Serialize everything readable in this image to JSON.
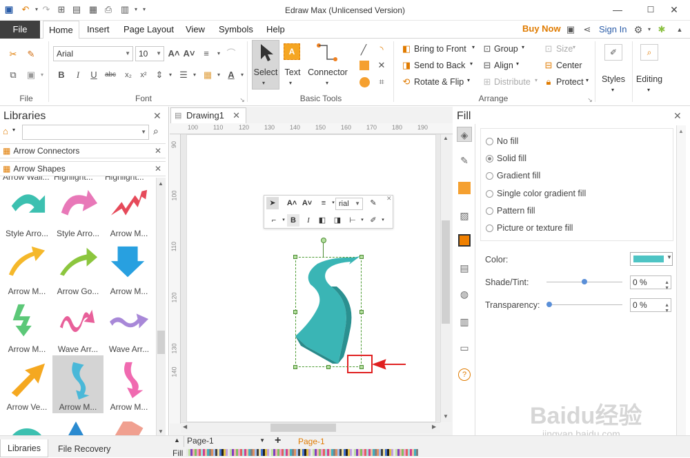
{
  "window": {
    "title": "Edraw Max (Unlicensed Version)"
  },
  "menu": {
    "file": "File",
    "tabs": [
      "Home",
      "Insert",
      "Page Layout",
      "View",
      "Symbols",
      "Help"
    ],
    "buy_now": "Buy Now",
    "sign_in": "Sign In"
  },
  "ribbon": {
    "groups": {
      "file": "File",
      "font": "Font",
      "basic_tools": "Basic Tools",
      "arrange": "Arrange"
    },
    "font_name": "Arial",
    "font_size": "10",
    "tools": {
      "select": "Select",
      "text": "Text",
      "connector": "Connector"
    },
    "arrange": {
      "bring_to_front": "Bring to Front",
      "send_to_back": "Send to Back",
      "rotate_flip": "Rotate & Flip",
      "group": "Group",
      "align": "Align",
      "distribute": "Distribute",
      "size": "Size",
      "center": "Center",
      "protect": "Protect"
    },
    "styles": "Styles",
    "editing": "Editing"
  },
  "libraries": {
    "title": "Libraries",
    "sections": [
      "Arrow Connectors",
      "Arrow Shapes"
    ],
    "top_partial": [
      "Arrow Wall...",
      "Highlight...",
      "Highlight..."
    ],
    "shapes": [
      {
        "label": "Style Arro...",
        "color": "#3cc0b0"
      },
      {
        "label": "Style Arro...",
        "color": "#e878b8"
      },
      {
        "label": "Arrow M...",
        "color": "#e64a5a"
      },
      {
        "label": "Arrow M...",
        "color": "#f5b82a"
      },
      {
        "label": "Arrow Go...",
        "color": "#8cc63e"
      },
      {
        "label": "Arrow M...",
        "color": "#28a0e0"
      },
      {
        "label": "Arrow M...",
        "color": "#5cc878"
      },
      {
        "label": "Wave Arr...",
        "color": "#e8609a"
      },
      {
        "label": "Wave Arr...",
        "color": "#a888d8"
      },
      {
        "label": "Arrow Ve...",
        "color": "#f5a820"
      },
      {
        "label": "Arrow M...",
        "color": "#4ab8d8"
      },
      {
        "label": "Arrow M...",
        "color": "#f06ab0"
      }
    ]
  },
  "document": {
    "tab": "Drawing1",
    "ruler_h": [
      "100",
      "110",
      "120",
      "130",
      "140",
      "150",
      "160",
      "170",
      "180",
      "190"
    ],
    "ruler_v": [
      "90",
      "100",
      "110",
      "120",
      "130",
      "140"
    ],
    "mini_toolbar_font": "rial",
    "page_tab": "Page-1",
    "page_tab_active": "Page-1"
  },
  "fill_panel": {
    "title": "Fill",
    "options": [
      "No fill",
      "Solid fill",
      "Gradient fill",
      "Single color gradient fill",
      "Pattern fill",
      "Picture or texture fill"
    ],
    "selected_option": "Solid fill",
    "color_label": "Color:",
    "color_value": "#4ec4c4",
    "shade_label": "Shade/Tint:",
    "shade_value": "0 %",
    "transparency_label": "Transparency:",
    "transparency_value": "0 %"
  },
  "status": {
    "libraries": "Libraries",
    "file_recovery": "File Recovery",
    "fill": "Fill"
  },
  "watermark": {
    "brand": "Baidu经验",
    "url": "jingyan.baidu.com"
  }
}
